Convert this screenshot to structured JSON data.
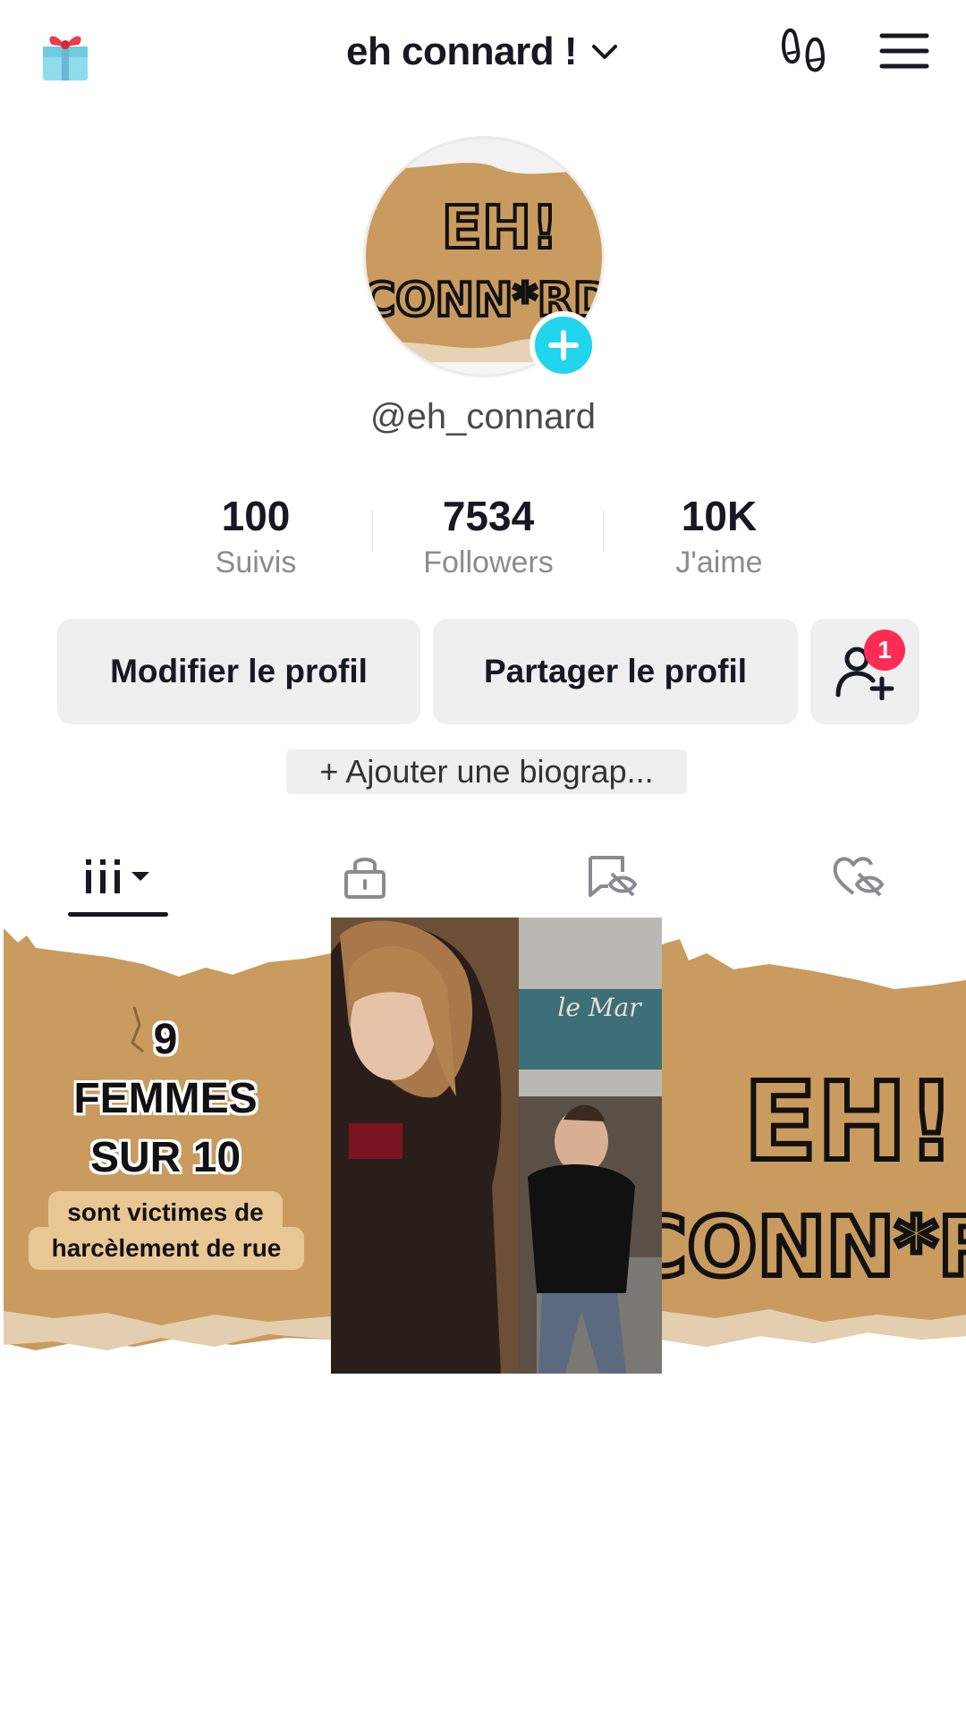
{
  "header": {
    "title": "eh connard !",
    "gift_icon": "gift-icon",
    "footprints_icon": "footprints-icon",
    "menu_icon": "hamburger-menu-icon"
  },
  "profile": {
    "handle": "@eh_connard",
    "avatar_text": "EH! CONN*RD",
    "stats": [
      {
        "value": "100",
        "label": "Suivis"
      },
      {
        "value": "7534",
        "label": "Followers"
      },
      {
        "value": "10K",
        "label": "J'aime"
      }
    ],
    "edit_label": "Modifier le profil",
    "share_label": "Partager le profil",
    "friend_requests_count": "1",
    "bio_label": "+ Ajouter une biograp..."
  },
  "tabs": [
    {
      "name": "tab-videos",
      "icon": "grid-bars-icon"
    },
    {
      "name": "tab-private",
      "icon": "lock-icon"
    },
    {
      "name": "tab-reposts-hidden",
      "icon": "repost-eye-off-icon"
    },
    {
      "name": "tab-liked-hidden",
      "icon": "heart-eye-off-icon"
    }
  ],
  "videos": [
    {
      "line1": "9",
      "line2": "FEMMES",
      "line3": "SUR 10",
      "caption1": "sont victimes de",
      "caption2": "harcèlement de rue"
    },
    {
      "sign_text": "le Mar"
    },
    {
      "logo_text": "EH! CONN*RD"
    }
  ],
  "colors": {
    "accent": "#20d5ec",
    "badge": "#fe2c55",
    "cardboard": "#c89a5c"
  }
}
